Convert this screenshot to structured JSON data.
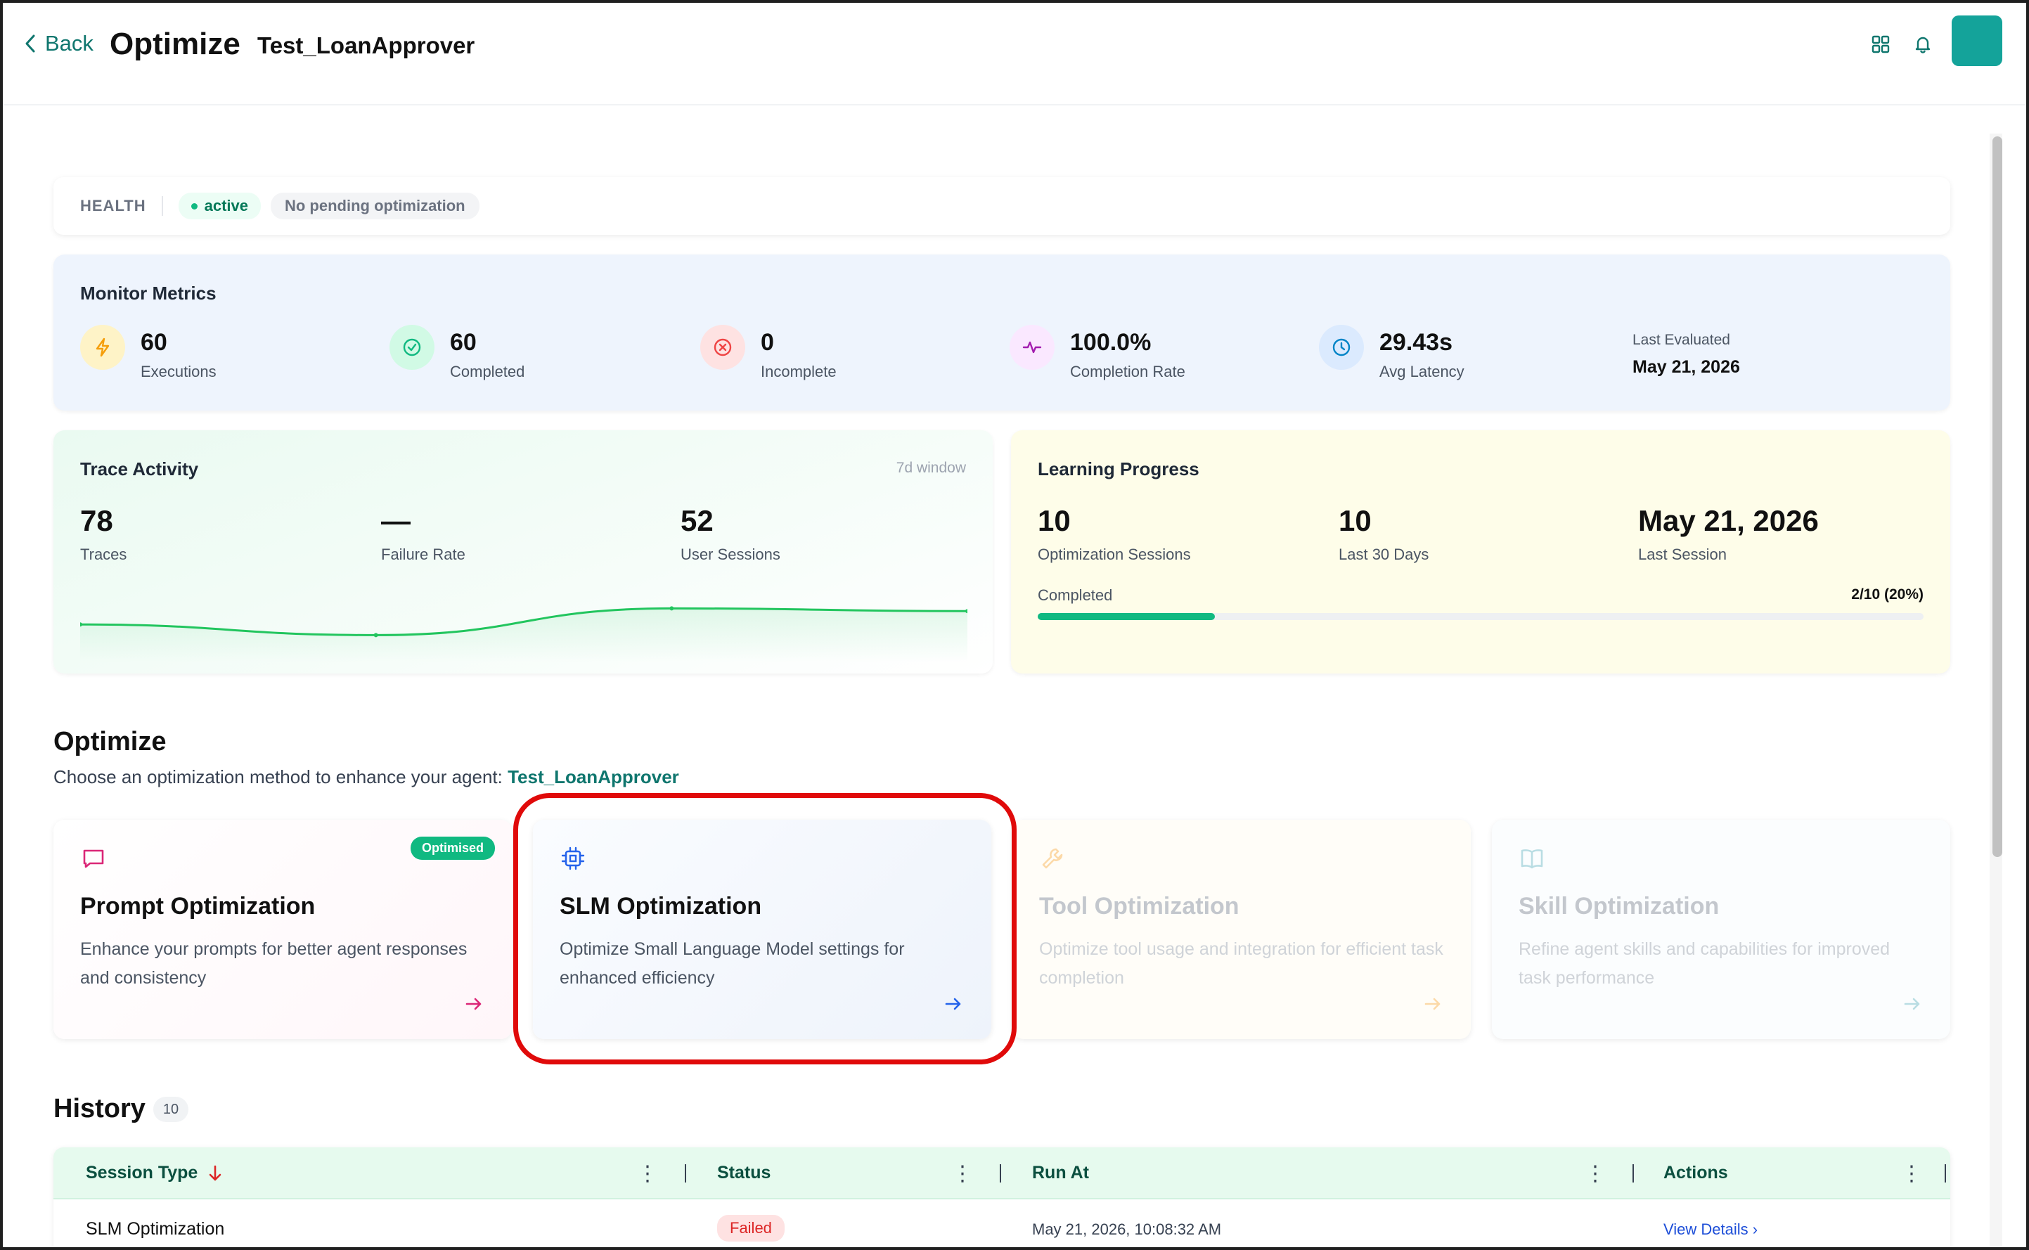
{
  "header": {
    "back_label": "Back",
    "title": "Optimize",
    "agent_name": "Test_LoanApprover",
    "icons": [
      "grid-icon",
      "bell-icon"
    ],
    "accent_color": "#14a39a"
  },
  "health": {
    "label": "HEALTH",
    "status": "active",
    "pending": "No pending optimization"
  },
  "monitor": {
    "title": "Monitor Metrics",
    "metrics": [
      {
        "value": "60",
        "label": "Executions",
        "icon": "bolt-icon",
        "color": "#f59e0b"
      },
      {
        "value": "60",
        "label": "Completed",
        "icon": "check-circle-icon",
        "color": "#10b981"
      },
      {
        "value": "0",
        "label": "Incomplete",
        "icon": "x-circle-icon",
        "color": "#ef4444"
      },
      {
        "value": "100.0%",
        "label": "Completion Rate",
        "icon": "activity-icon",
        "color": "#a21caf"
      },
      {
        "value": "29.43s",
        "label": "Avg Latency",
        "icon": "clock-icon",
        "color": "#0284c7"
      }
    ],
    "last_evaluated_label": "Last Evaluated",
    "last_evaluated_value": "May 21, 2026"
  },
  "trace": {
    "title": "Trace Activity",
    "window": "7d window",
    "stats": [
      {
        "value": "78",
        "label": "Traces"
      },
      {
        "value": "—",
        "label": "Failure Rate"
      },
      {
        "value": "52",
        "label": "User Sessions"
      }
    ],
    "sparkline": [
      0.55,
      0.35,
      0.85,
      0.8
    ]
  },
  "learning": {
    "title": "Learning Progress",
    "stats": [
      {
        "value": "10",
        "label": "Optimization Sessions"
      },
      {
        "value": "10",
        "label": "Last 30 Days"
      },
      {
        "value": "May 21, 2026",
        "label": "Last Session"
      }
    ],
    "progress_label": "Completed",
    "progress_text": "2/10 (20%)",
    "progress_fraction": 0.2
  },
  "optimize": {
    "title": "Optimize",
    "subtitle": "Choose an optimization method to enhance your agent: ",
    "agent_name": "Test_LoanApprover",
    "cards": [
      {
        "title": "Prompt Optimization",
        "desc": "Enhance your prompts for better agent responses and consistency",
        "badge": "Optimised",
        "icon": "chat-icon"
      },
      {
        "title": "SLM Optimization",
        "desc": "Optimize Small Language Model settings for enhanced efficiency",
        "icon": "chip-icon"
      },
      {
        "title": "Tool Optimization",
        "desc": "Optimize tool usage and integration for efficient task completion",
        "icon": "wrench-icon"
      },
      {
        "title": "Skill Optimization",
        "desc": "Refine agent skills and capabilities for improved task performance",
        "icon": "book-icon"
      }
    ]
  },
  "history": {
    "title": "History",
    "count": "10",
    "columns": [
      "Session Type",
      "Status",
      "Run At",
      "Actions"
    ],
    "rows": [
      {
        "session_type": "SLM Optimization",
        "status": "Failed",
        "run_at": "May 21, 2026, 10:08:32 AM",
        "action": "View Details ›"
      }
    ]
  }
}
